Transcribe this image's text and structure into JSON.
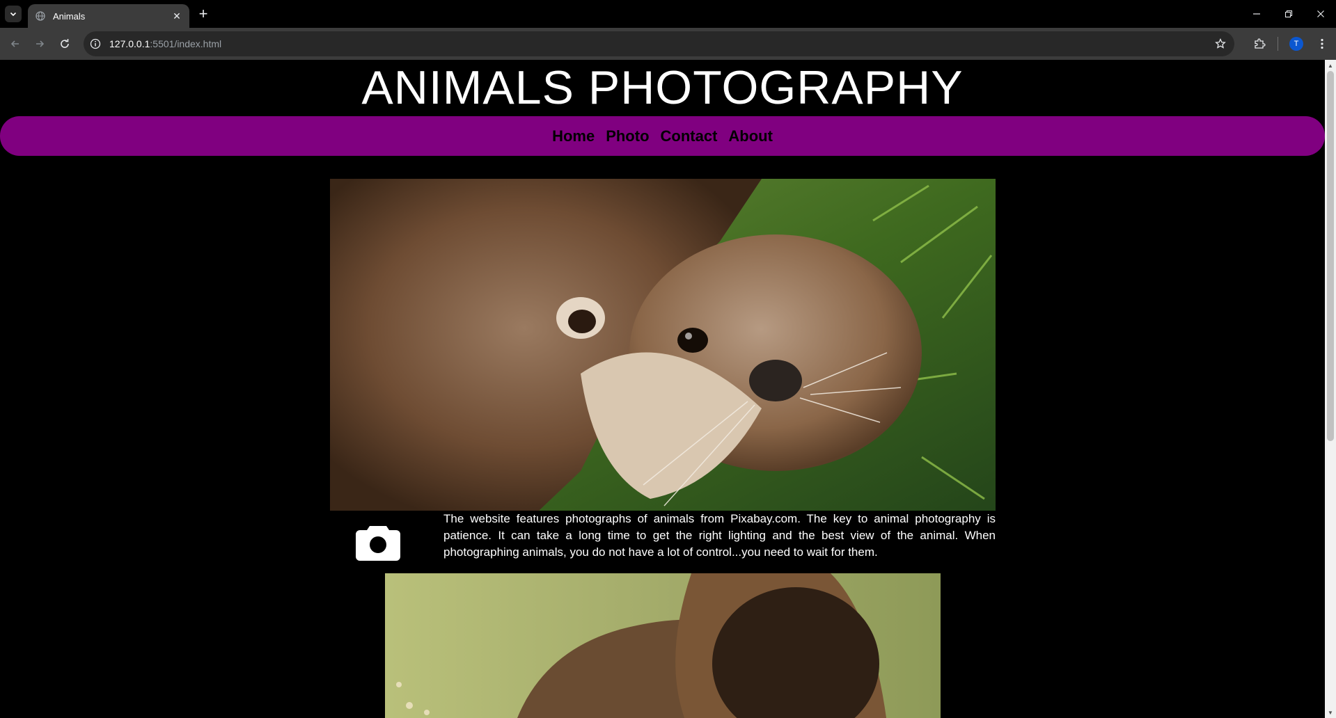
{
  "browser": {
    "tab_title": "Animals",
    "url_host": "127.0.0.1",
    "url_path": ":5501/index.html",
    "profile_initial": "T"
  },
  "page": {
    "site_title": "ANIMALS PHOTOGRAPHY",
    "nav": [
      {
        "label": "Home"
      },
      {
        "label": "Photo"
      },
      {
        "label": "Contact"
      },
      {
        "label": "About"
      }
    ],
    "nav_color": "#800080",
    "hero_image_alt": "otter",
    "intro_text": "The website features photographs of animals from Pixabay.com. The key to animal photography is patience. It can take a long time to get the right lighting and the best view of the animal. When photographing animals, you do not have a lot of control...you need to wait for them.",
    "second_image_alt": "bison"
  }
}
